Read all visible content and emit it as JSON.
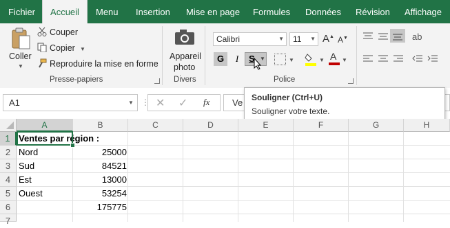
{
  "menu": {
    "items": [
      {
        "label": "Fichier"
      },
      {
        "label": "Accueil"
      },
      {
        "label": "Menu"
      },
      {
        "label": "Insertion"
      },
      {
        "label": "Mise en page"
      },
      {
        "label": "Formules"
      },
      {
        "label": "Données"
      },
      {
        "label": "Révision"
      },
      {
        "label": "Affichage"
      }
    ],
    "active": "Accueil"
  },
  "ribbon": {
    "clipboard": {
      "paste_label": "Coller",
      "cut_label": "Couper",
      "copy_label": "Copier",
      "format_painter_label": "Reproduire la mise en forme",
      "group_label": "Presse-papiers"
    },
    "misc": {
      "camera_label_line1": "Appareil",
      "camera_label_line2": "photo",
      "group_label": "Divers"
    },
    "font": {
      "font_name": "Calibri",
      "font_size": "11",
      "bold": "G",
      "italic": "I",
      "underline": "S",
      "group_label": "Police",
      "fill_color": "#FFFF00",
      "font_color": "#C00000"
    }
  },
  "formula_bar": {
    "name_box": "A1",
    "fx": "fx",
    "content": "Ve"
  },
  "tooltip": {
    "title": "Souligner (Ctrl+U)",
    "description": "Souligner votre texte."
  },
  "grid": {
    "columns": [
      "A",
      "B",
      "C",
      "D",
      "E",
      "F",
      "G",
      "H"
    ],
    "rows": [
      "1",
      "2",
      "3",
      "4",
      "5",
      "6",
      "7"
    ],
    "cells": {
      "A1": "Ventes par région :",
      "A2": "Nord",
      "B2": "25000",
      "A3": "Sud",
      "B3": "84521",
      "A4": "Est",
      "B4": "13000",
      "A5": "Ouest",
      "B5": "53254",
      "B6": "175775"
    },
    "selected": "A1"
  },
  "colors": {
    "brand": "#217346",
    "ribbon_bg": "#F3F3F3"
  }
}
